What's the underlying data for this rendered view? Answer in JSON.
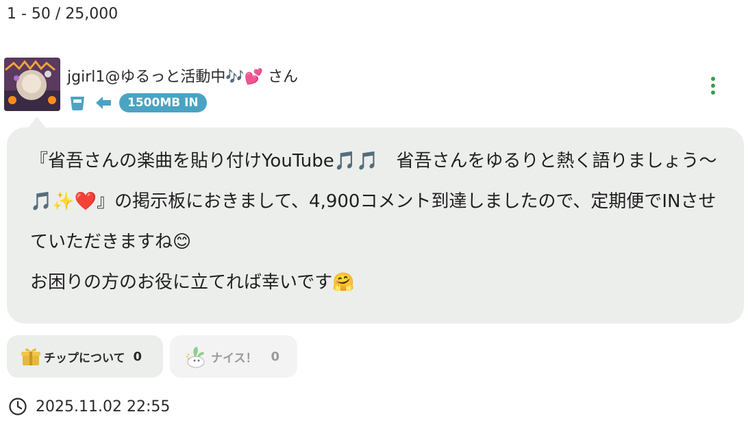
{
  "pagination": {
    "range": "1 - 50 / 25,000"
  },
  "post": {
    "username": "jgirl1@ゆるっと活動中🎶💕 さん",
    "badge": "1500MB IN",
    "message_lines": [
      "『省吾さんの楽曲を貼り付けYouTube🎵🎵　省吾さんをゆるりと熱く語りましょう〜🎵✨❤️』の掲示板におきまして、4,900コメント到達しましたので、定期便でINさせていただきますね😊",
      "お困りの方のお役に立てれば幸いです🤗"
    ],
    "timestamp": "2025.11.02 22:55"
  },
  "actions": {
    "tip_label": "チップについて",
    "tip_count": "0",
    "nice_label": "ナイス！",
    "nice_count": "0"
  },
  "icons": {
    "avatar": "avatar",
    "cup": "cup-icon",
    "arrow": "arrow-left-icon",
    "more": "more-vertical-icon",
    "gift": "gift-icon",
    "nice": "nice-mascot-icon",
    "clock": "clock-icon"
  },
  "colors": {
    "accent_blue": "#4aa3c3",
    "kebab_green": "#3b9a55",
    "bubble_bg": "#eceeec",
    "gift_gold": "#e6b93a"
  }
}
